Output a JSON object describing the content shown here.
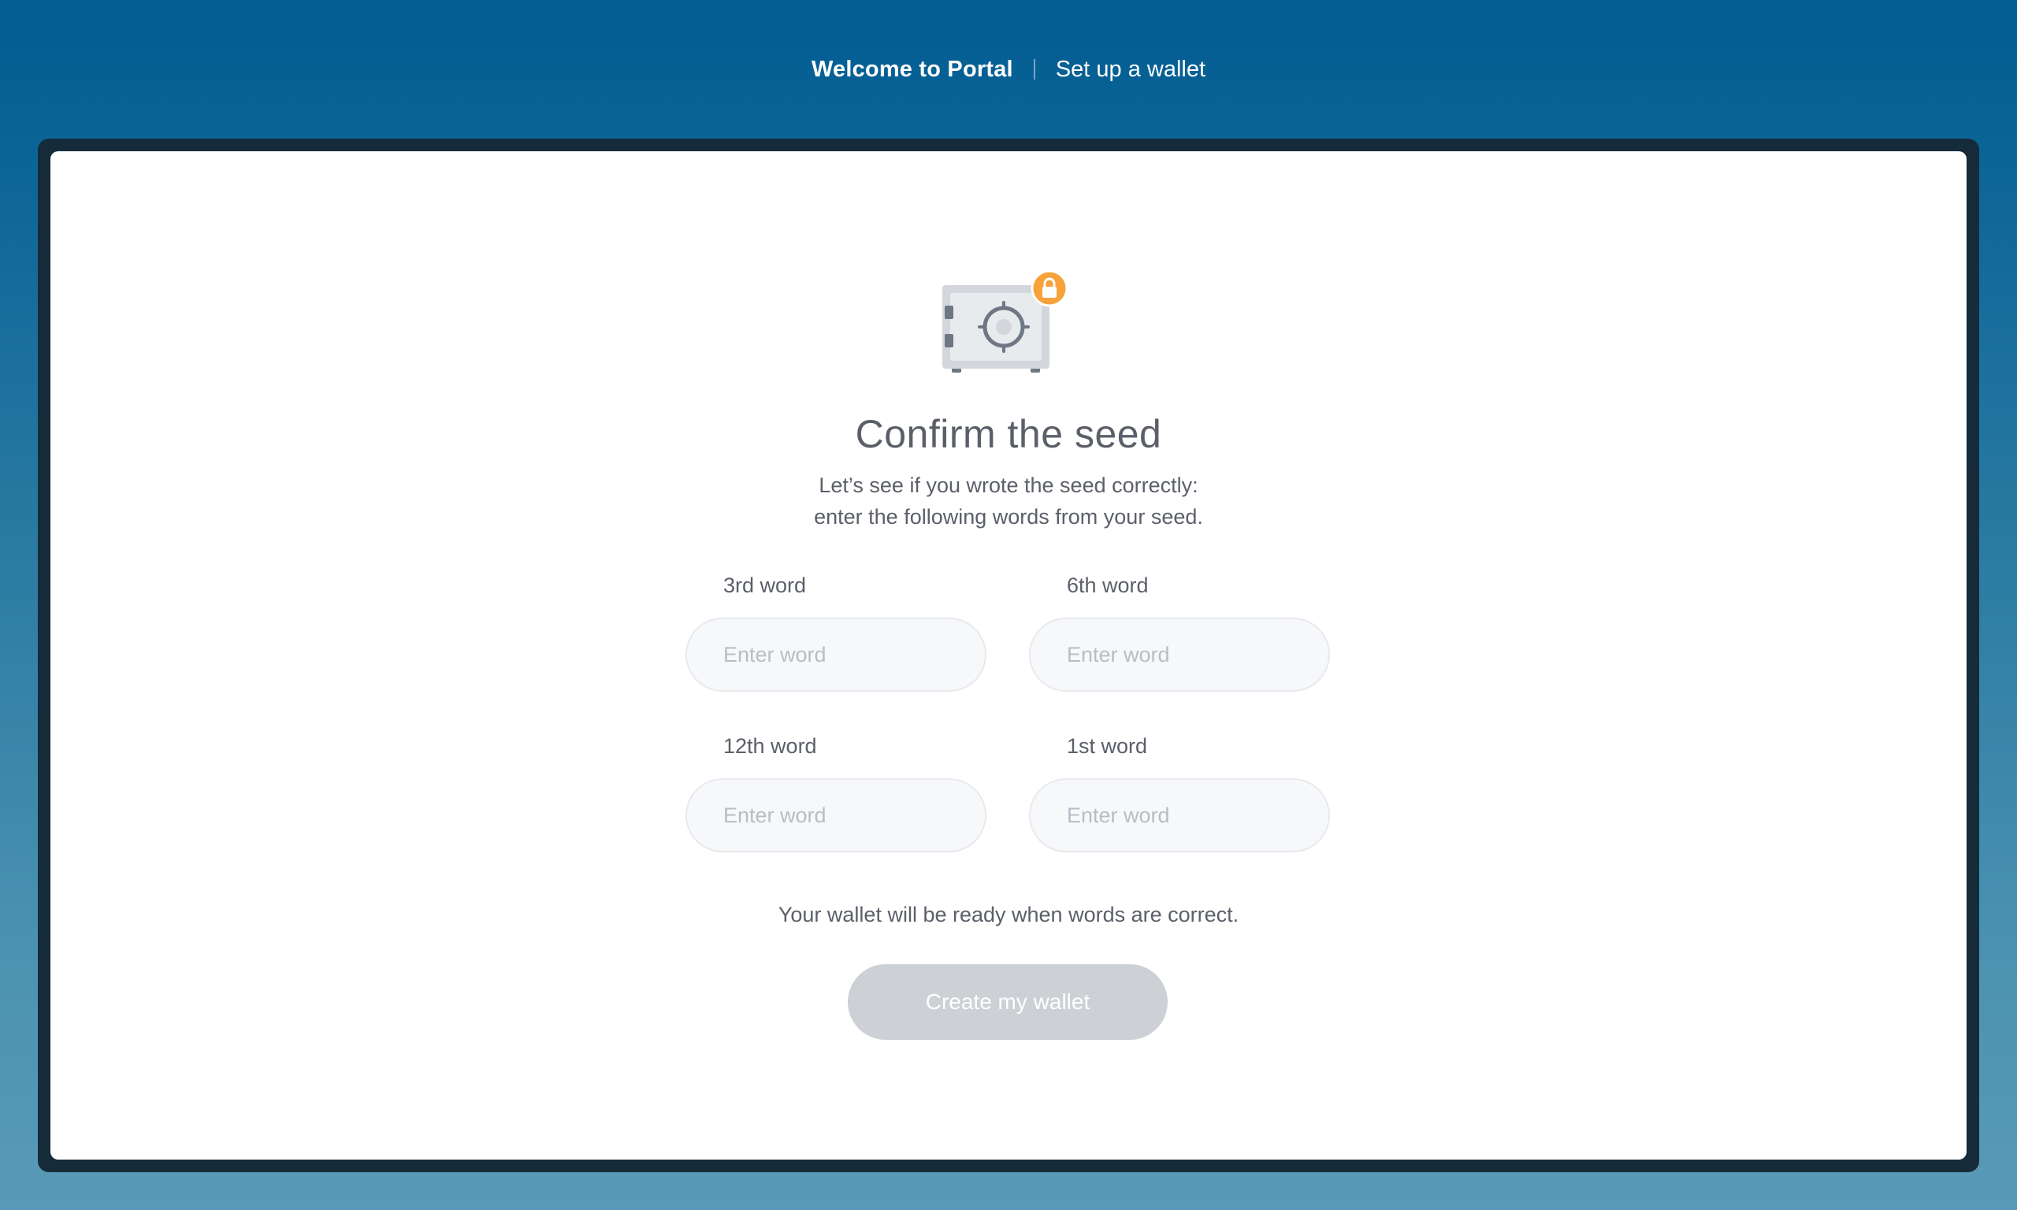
{
  "header": {
    "title": "Welcome to Portal",
    "step": "Set up a wallet"
  },
  "main": {
    "icon": "safe-lock-icon",
    "heading": "Confirm the seed",
    "subtitle_line1": "Let’s see if you wrote the seed correctly:",
    "subtitle_line2": "enter the following words from your seed.",
    "fields": [
      {
        "label": "3rd word",
        "placeholder": "Enter word",
        "value": ""
      },
      {
        "label": "6th word",
        "placeholder": "Enter word",
        "value": ""
      },
      {
        "label": "12th word",
        "placeholder": "Enter word",
        "value": ""
      },
      {
        "label": "1st word",
        "placeholder": "Enter word",
        "value": ""
      }
    ],
    "ready_text": "Your wallet will be ready when words are correct.",
    "create_button": "Create my wallet"
  },
  "colors": {
    "accent": "#f7a23b",
    "button_disabled": "#cdd0d5",
    "text": "#5b5f69",
    "frame": "#152b3a"
  }
}
